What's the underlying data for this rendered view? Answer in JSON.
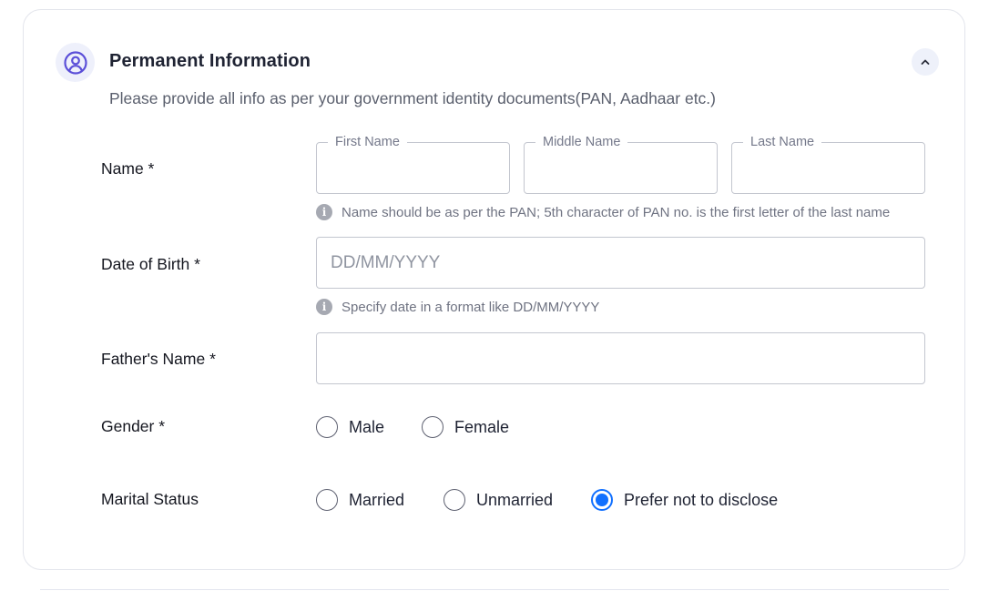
{
  "section": {
    "title": "Permanent Information",
    "subtitle": "Please provide all info as per your government identity documents(PAN, Aadhaar etc.)",
    "icon": "user-circle-icon",
    "collapse_icon": "chevron-up-icon"
  },
  "name": {
    "label": "Name *",
    "first_name": {
      "legend": "First Name",
      "value": ""
    },
    "middle_name": {
      "legend": "Middle Name",
      "value": ""
    },
    "last_name": {
      "legend": "Last Name",
      "value": ""
    },
    "hint": "Name should be as per the PAN; 5th character of PAN no. is the first letter of the last name"
  },
  "dob": {
    "label": "Date of Birth *",
    "placeholder": "DD/MM/YYYY",
    "value": "",
    "hint": "Specify date in a format like DD/MM/YYYY"
  },
  "father": {
    "label": "Father's Name *",
    "value": ""
  },
  "gender": {
    "label": "Gender *",
    "options": [
      "Male",
      "Female"
    ],
    "selected": null
  },
  "marital": {
    "label": "Marital Status",
    "options": [
      "Married",
      "Unmarried",
      "Prefer not to disclose"
    ],
    "selected": "Prefer not to disclose"
  },
  "colors": {
    "accent": "#1170ff",
    "icon_purple": "#5b4fd8",
    "border": "#c3c6cf"
  }
}
